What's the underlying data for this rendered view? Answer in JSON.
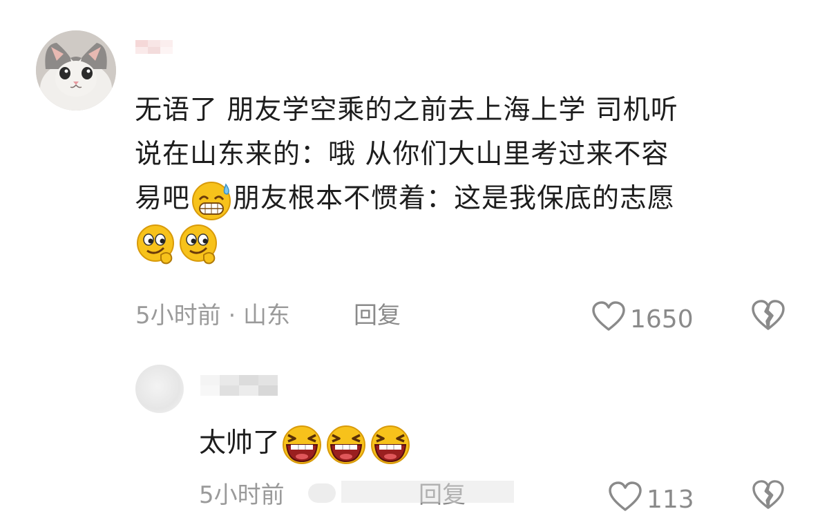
{
  "comment": {
    "text_line1": "无语了 朋友学空乘的之前去上海上学 司机听",
    "text_line2": "说在山东来的：哦 从你们大山里考过来不容",
    "text_line3a": "易吧",
    "text_line3b": "朋友根本不惯着：这是我保底的志愿",
    "emoji_inline": "sweat-grin-emoji",
    "emoji_trailing": [
      "smirk-emoji",
      "smirk-emoji"
    ],
    "time_location": "5小时前 · 山东",
    "reply_label": "回复",
    "likes": "1650"
  },
  "reply": {
    "text": "太帅了",
    "emojis": [
      "laughing-emoji",
      "laughing-emoji",
      "laughing-emoji"
    ],
    "time": "5小时前",
    "reply_label": "回复",
    "likes": "113"
  },
  "colors": {
    "meta": "#9a9a9a",
    "text": "#1d1d1d",
    "emoji_yellow": "#f7c21b"
  },
  "icons": [
    "heart-outline-icon",
    "broken-heart-icon"
  ]
}
